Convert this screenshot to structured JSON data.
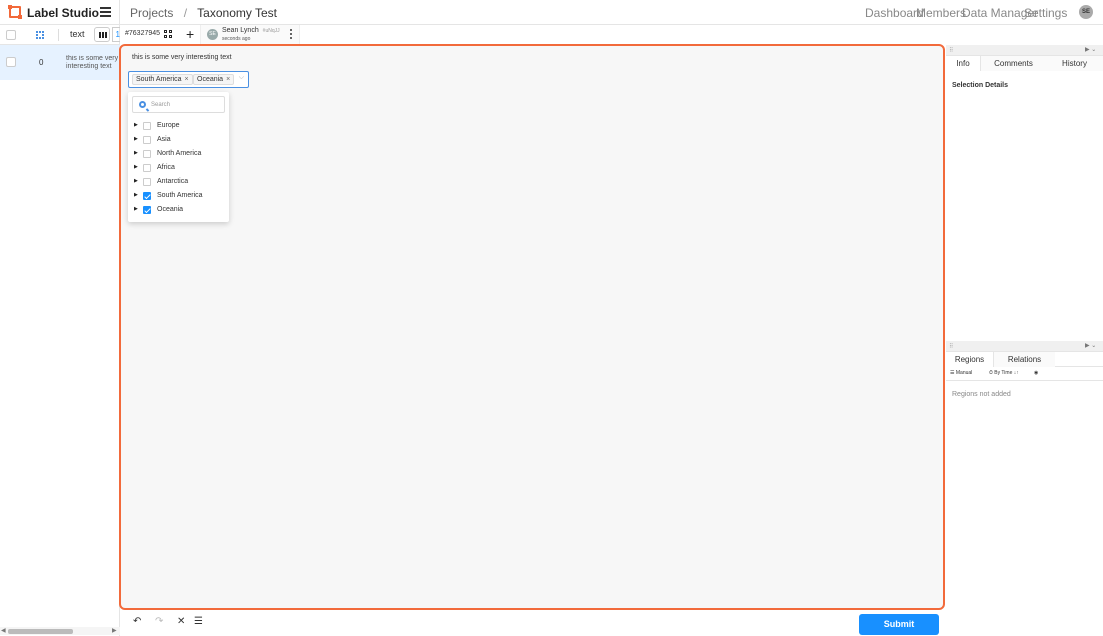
{
  "app": {
    "name": "Label Studio"
  },
  "breadcrumb": {
    "projects": "Projects",
    "separator": "/",
    "current": "Taxonomy Test"
  },
  "nav": [
    "Dashboard",
    "Members",
    "Data Manager",
    "Settings"
  ],
  "user": {
    "initials": "SE"
  },
  "left_panel": {
    "column_label": "text",
    "more_columns": "1",
    "rows": [
      {
        "id": "0",
        "text": "this is some very interesting text"
      }
    ]
  },
  "annotation": {
    "task_id": "#76327945",
    "user_initials": "SE",
    "user_name": "Sean Lynch",
    "user_handle": "#uNqJJ",
    "time": "seconds ago"
  },
  "main": {
    "text": "this is some very interesting text",
    "selected_tags": [
      "South America",
      "Oceania"
    ],
    "search_placeholder": "Search",
    "options": [
      {
        "label": "Europe",
        "checked": false
      },
      {
        "label": "Asia",
        "checked": false
      },
      {
        "label": "North America",
        "checked": false
      },
      {
        "label": "Africa",
        "checked": false
      },
      {
        "label": "Antarctica",
        "checked": false
      },
      {
        "label": "South America",
        "checked": true
      },
      {
        "label": "Oceania",
        "checked": true
      }
    ]
  },
  "bottom": {
    "submit": "Submit"
  },
  "info_panel": {
    "tabs": [
      "Info",
      "Comments",
      "History"
    ],
    "heading": "Selection Details"
  },
  "regions_panel": {
    "tabs": [
      "Regions",
      "Relations"
    ],
    "manual": "Manual",
    "by_time": "By Time",
    "empty": "Regions not added"
  },
  "colors": {
    "accent": "#1890ff",
    "highlight_border": "#f26a3b"
  }
}
